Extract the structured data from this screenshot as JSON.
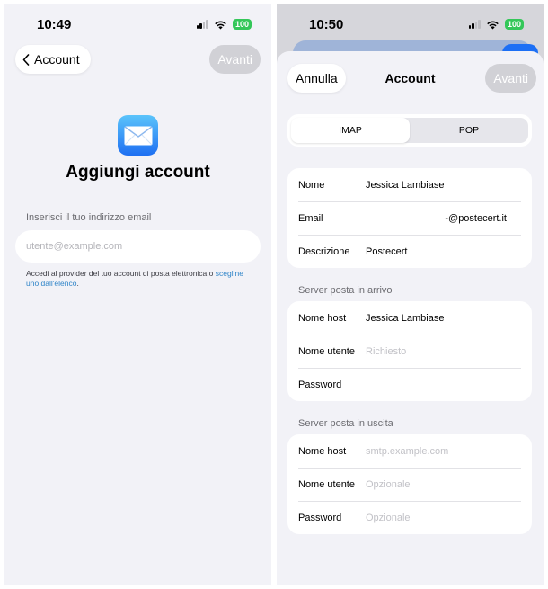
{
  "left": {
    "time": "10:49",
    "battery": "100",
    "back_label": "Account",
    "next_label": "Avanti",
    "title": "Aggiungi account",
    "email_label": "Inserisci il tuo indirizzo email",
    "email_placeholder": "utente@example.com",
    "help_text": "Accedi al provider del tuo account di posta elettronica o ",
    "help_link": "scegline uno dall'elenco",
    "help_end": "."
  },
  "right": {
    "time": "10:50",
    "battery": "100",
    "cancel_label": "Annulla",
    "title": "Account",
    "next_label": "Avanti",
    "tabs": [
      {
        "label": "IMAP",
        "active": true
      },
      {
        "label": "POP",
        "active": false
      }
    ],
    "account": [
      {
        "label": "Nome",
        "value": "Jessica Lambiase",
        "placeholder": false
      },
      {
        "label": "Email",
        "value": "‑@postecert.it",
        "placeholder": false
      },
      {
        "label": "Descrizione",
        "value": "Postecert",
        "placeholder": false
      }
    ],
    "incoming_title": "Server posta in arrivo",
    "incoming": [
      {
        "label": "Nome host",
        "value": "Jessica Lambiase",
        "placeholder": false
      },
      {
        "label": "Nome utente",
        "value": "Richiesto",
        "placeholder": true
      },
      {
        "label": "Password",
        "value": "",
        "placeholder": false
      }
    ],
    "outgoing_title": "Server posta in uscita",
    "outgoing": [
      {
        "label": "Nome host",
        "value": "smtp.example.com",
        "placeholder": true
      },
      {
        "label": "Nome utente",
        "value": "Opzionale",
        "placeholder": true
      },
      {
        "label": "Password",
        "value": "Opzionale",
        "placeholder": true
      }
    ]
  },
  "colors": {
    "accent_link": "#2e84c8",
    "battery": "#34c759",
    "disabled_button": "#d1d1d6",
    "background": "#f2f2f7"
  }
}
